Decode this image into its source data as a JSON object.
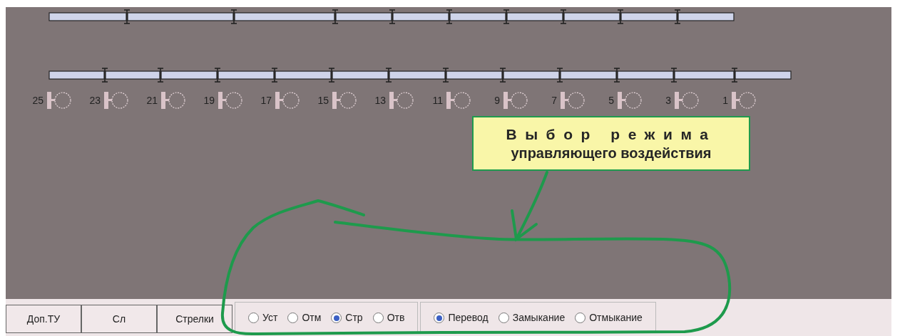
{
  "signals": [
    {
      "number": "25"
    },
    {
      "number": "23"
    },
    {
      "number": "21"
    },
    {
      "number": "19"
    },
    {
      "number": "17"
    },
    {
      "number": "15"
    },
    {
      "number": "13"
    },
    {
      "number": "11"
    },
    {
      "number": "9"
    },
    {
      "number": "7"
    },
    {
      "number": "5"
    },
    {
      "number": "3"
    },
    {
      "number": "1"
    }
  ],
  "callout": {
    "lines": [
      "Выбор режима",
      "управляющего воздействия"
    ]
  },
  "buttons": [
    "Доп.ТУ",
    "Сл",
    "Стрелки"
  ],
  "radio_groups": [
    {
      "options": [
        {
          "label": "Уст",
          "selected": false
        },
        {
          "label": "Отм",
          "selected": false
        },
        {
          "label": "Стр",
          "selected": true
        },
        {
          "label": "Отв",
          "selected": false
        }
      ]
    },
    {
      "options": [
        {
          "label": "Перевод",
          "selected": true
        },
        {
          "label": "Замыкание",
          "selected": false
        },
        {
          "label": "Отмыкание",
          "selected": false
        }
      ]
    }
  ]
}
